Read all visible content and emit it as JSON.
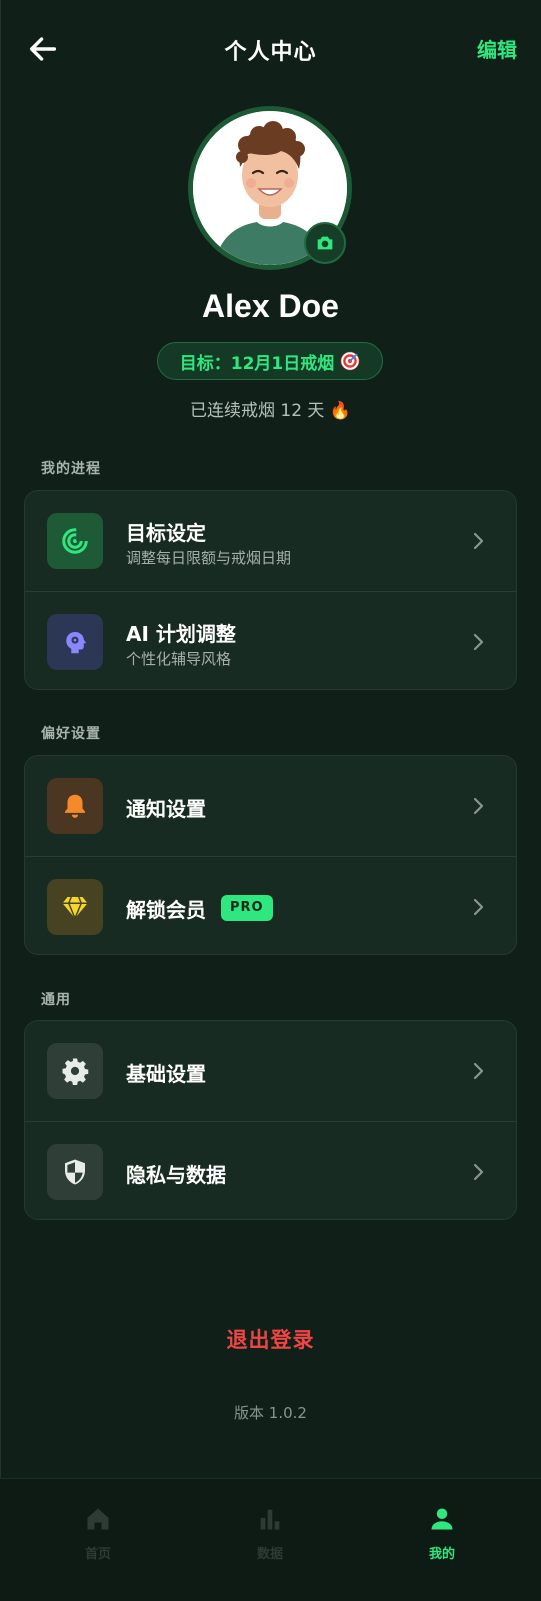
{
  "header": {
    "title": "个人中心",
    "edit_label": "编辑"
  },
  "profile": {
    "name": "Alex Doe",
    "goal_badge": "目标：12月1日戒烟",
    "streak_text": "已连续戒烟 12 天",
    "streak_emoji": "🔥"
  },
  "sections": [
    {
      "label": "我的进程",
      "items": [
        {
          "title": "目标设定",
          "subtitle": "调整每日限额与戒烟日期",
          "icon": "target-icon",
          "color": "#2ee77e"
        },
        {
          "title": "AI 计划调整",
          "subtitle": "个性化辅导风格",
          "icon": "brain-icon",
          "color": "#8a86ff"
        }
      ]
    },
    {
      "label": "偏好设置",
      "items": [
        {
          "title": "通知设置",
          "icon": "bell-icon",
          "color": "#f48a2a"
        },
        {
          "title": "解锁会员",
          "badge": "PRO",
          "icon": "diamond-icon",
          "color": "#f3d82a"
        }
      ]
    },
    {
      "label": "通用",
      "items": [
        {
          "title": "基础设置",
          "icon": "gear-icon",
          "color": "#e7ece9"
        },
        {
          "title": "隐私与数据",
          "icon": "shield-icon",
          "color": "#e7ece9"
        }
      ]
    }
  ],
  "logout_label": "退出登录",
  "version_label": "版本 1.0.2",
  "bottom_nav": [
    {
      "label": "首页",
      "icon": "home-icon",
      "active": false
    },
    {
      "label": "数据",
      "icon": "bar-chart-icon",
      "active": false
    },
    {
      "label": "我的",
      "icon": "person-icon",
      "active": true
    }
  ],
  "colors": {
    "accent": "#2ee77e",
    "danger": "#ef4545",
    "background": "#102019",
    "card": "#182b22"
  }
}
